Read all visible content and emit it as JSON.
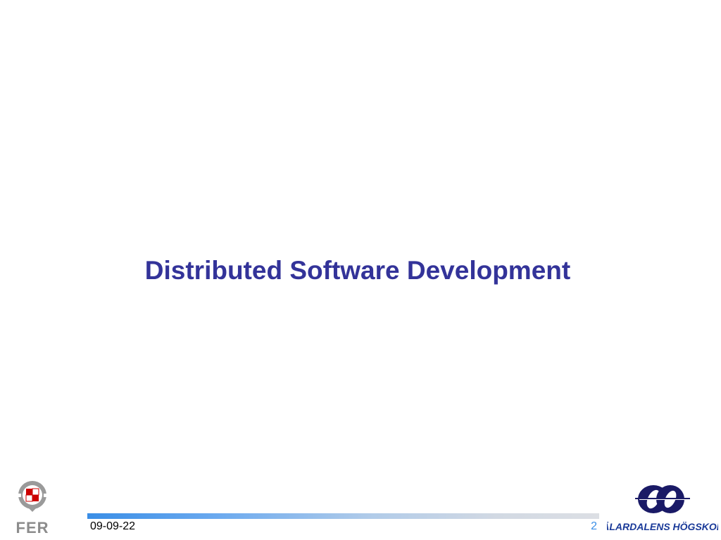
{
  "slide": {
    "title": "Distributed Software Development",
    "date": "09-09-22",
    "page_number": "2"
  },
  "logos": {
    "left_text": "FER",
    "right_text": "MÄLARDALENS HÖGSKOLA"
  },
  "colors": {
    "title": "#333399",
    "accent_blue": "#3a8ee6",
    "logo_red": "#cc0000",
    "logo_gray": "#8c8c8c",
    "logo_navy": "#1a1a66"
  }
}
